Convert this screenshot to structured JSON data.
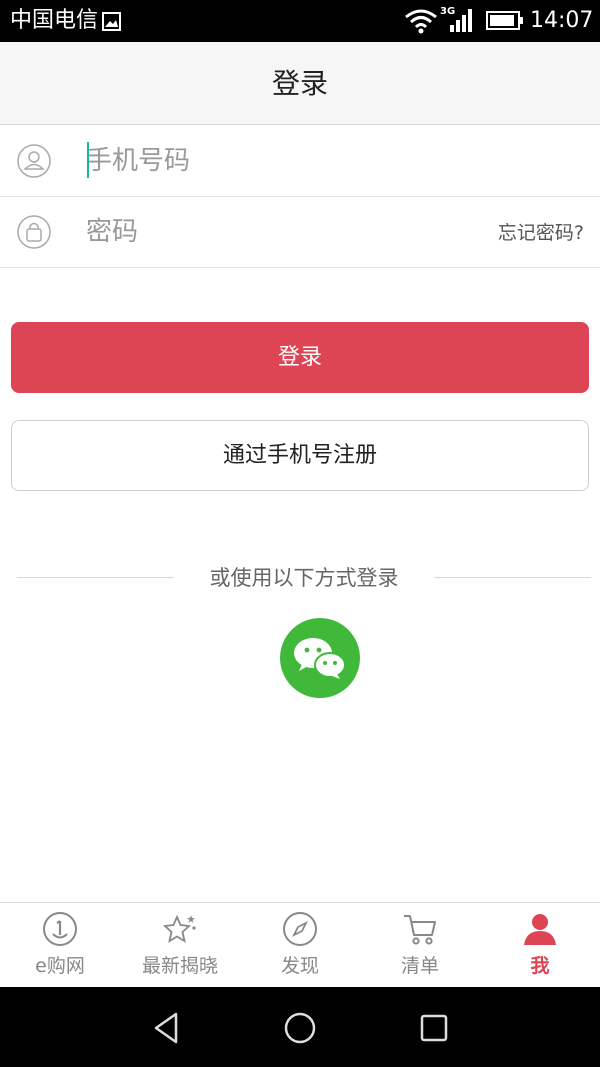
{
  "status_bar": {
    "carrier": "中国电信",
    "network": "3G",
    "time": "14:07",
    "icons": [
      "image-icon",
      "wifi-icon",
      "signal-icon",
      "battery-icon"
    ]
  },
  "header": {
    "title": "登录"
  },
  "form": {
    "phone_placeholder": "手机号码",
    "password_placeholder": "密码",
    "forgot_password": "忘记密码?"
  },
  "buttons": {
    "login": "登录",
    "register": "通过手机号注册"
  },
  "alt_login": {
    "label": "或使用以下方式登录",
    "provider_icon": "wechat-icon"
  },
  "tabs": [
    {
      "label": "e购网",
      "icon": "e-coin-icon",
      "active": false
    },
    {
      "label": "最新揭晓",
      "icon": "stars-icon",
      "active": false
    },
    {
      "label": "发现",
      "icon": "compass-icon",
      "active": false
    },
    {
      "label": "清单",
      "icon": "cart-icon",
      "active": false
    },
    {
      "label": "我",
      "icon": "user-icon",
      "active": true
    }
  ],
  "colors": {
    "accent": "#dd4555",
    "wechat": "#40b93a",
    "inactive_tab": "#888888"
  }
}
